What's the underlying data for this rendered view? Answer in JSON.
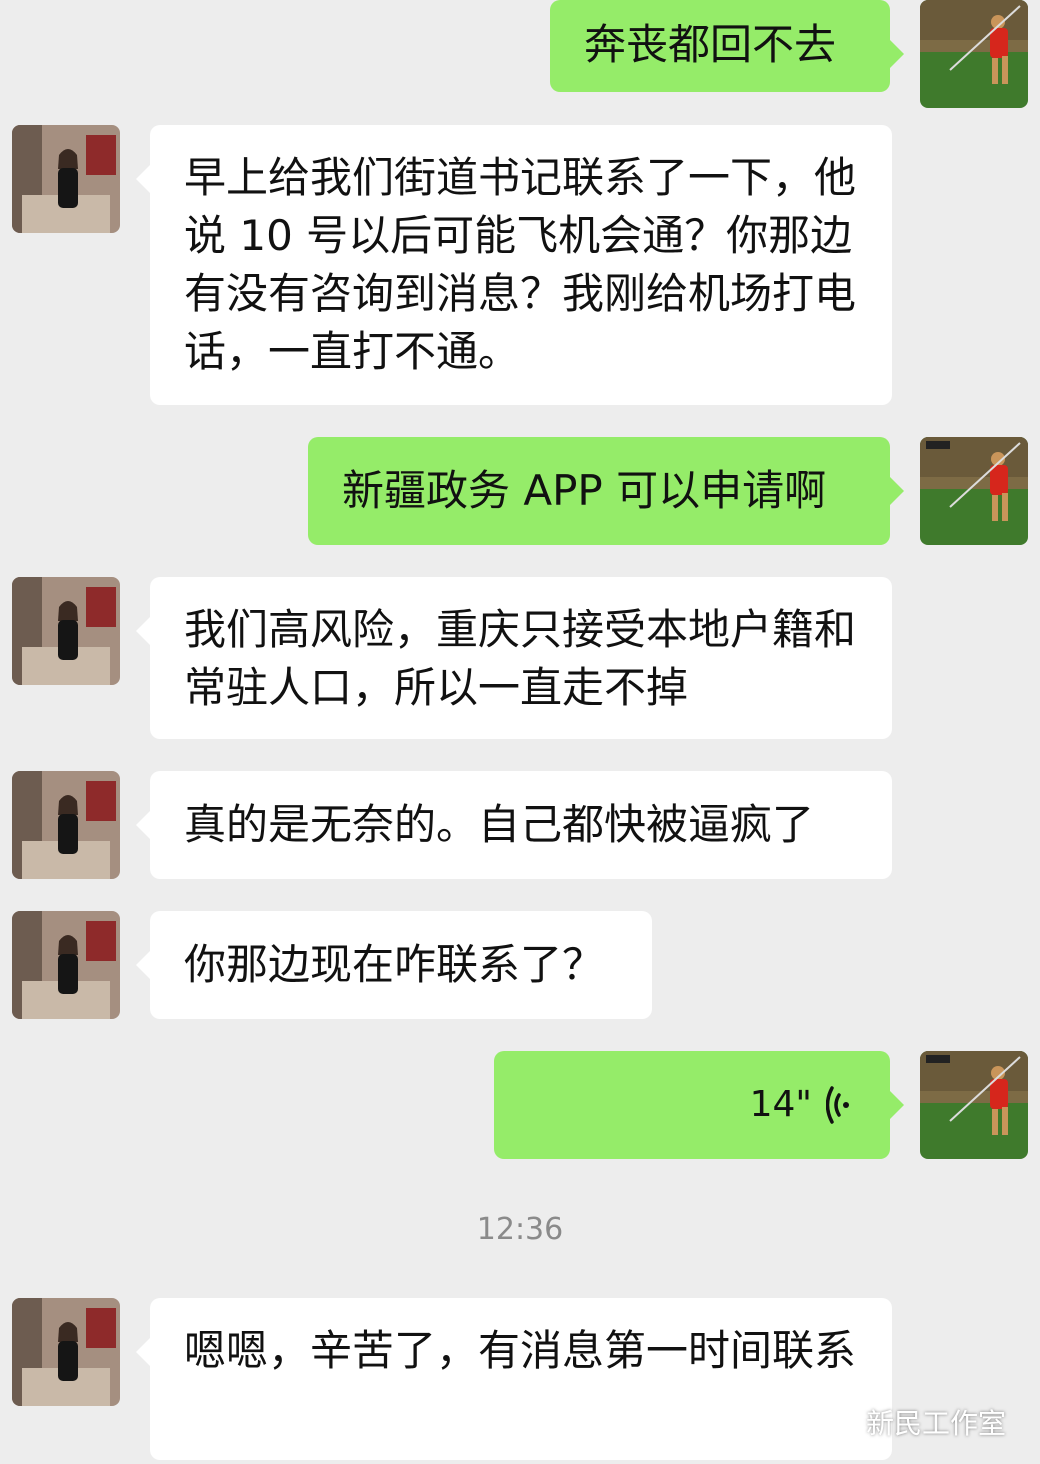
{
  "chat": {
    "messages": [
      {
        "sender": "self",
        "text": "奔丧都回不去"
      },
      {
        "sender": "other",
        "text": "早上给我们街道书记联系了一下，他说 10 号以后可能飞机会通？你那边有没有咨询到消息？我刚给机场打电话，一直打不通。"
      },
      {
        "sender": "self",
        "text": "新疆政务 APP 可以申请啊"
      },
      {
        "sender": "other",
        "text": "我们高风险，重庆只接受本地户籍和常驻人口，所以一直走不掉"
      },
      {
        "sender": "other",
        "text": "真的是无奈的。自己都快被逼疯了"
      },
      {
        "sender": "other",
        "text": "你那边现在咋联系了？"
      },
      {
        "sender": "self",
        "type": "voice",
        "duration": "14\""
      },
      {
        "sender": "other",
        "text": "嗯嗯，辛苦了，有消息第一时间联系"
      }
    ],
    "timestamp": "12:36"
  },
  "watermark": {
    "text": "新民工作室",
    "icon": "wechat-icon"
  },
  "colors": {
    "background": "#ededed",
    "bubble_self": "#95ec69",
    "bubble_other": "#ffffff",
    "timestamp": "#8a8a8a"
  }
}
